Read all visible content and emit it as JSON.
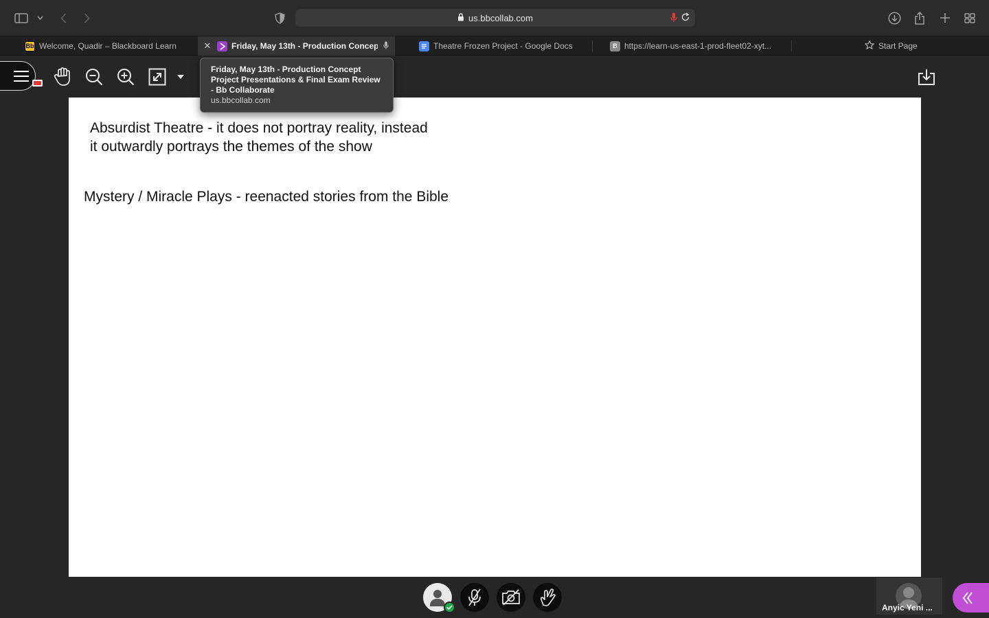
{
  "browser": {
    "url": "us.bbcollab.com",
    "colors": {
      "accent_purple": "#c14fd6",
      "mic_red": "#e23a3a",
      "check_green": "#21a64a"
    }
  },
  "tabs": [
    {
      "label": "Welcome, Quadir – Blackboard Learn",
      "favicon": "Bb"
    },
    {
      "label": "Friday, May 13th - Production Concept P...",
      "favicon": "collab-icon",
      "active": true
    },
    {
      "label": "Theatre Frozen Project - Google Docs",
      "favicon": "docs-icon"
    },
    {
      "label": "https://learn-us-east-1-prod-fleet02-xyt...",
      "favicon": "B"
    },
    {
      "label": "Start Page",
      "favicon": "star-icon"
    }
  ],
  "tooltip": {
    "title": "Friday, May 13th - Production Concept Project Presentations & Final Exam Review - Bb Collaborate",
    "url": "us.bbcollab.com"
  },
  "whiteboard": {
    "note1": "Absurdist Theatre - it does not portray reality, instead it outwardly portrays the themes of the show",
    "note2": "Mystery / Miracle Plays - reenacted stories from the Bible"
  },
  "participant": {
    "name": "Anyic Yeni ..."
  }
}
